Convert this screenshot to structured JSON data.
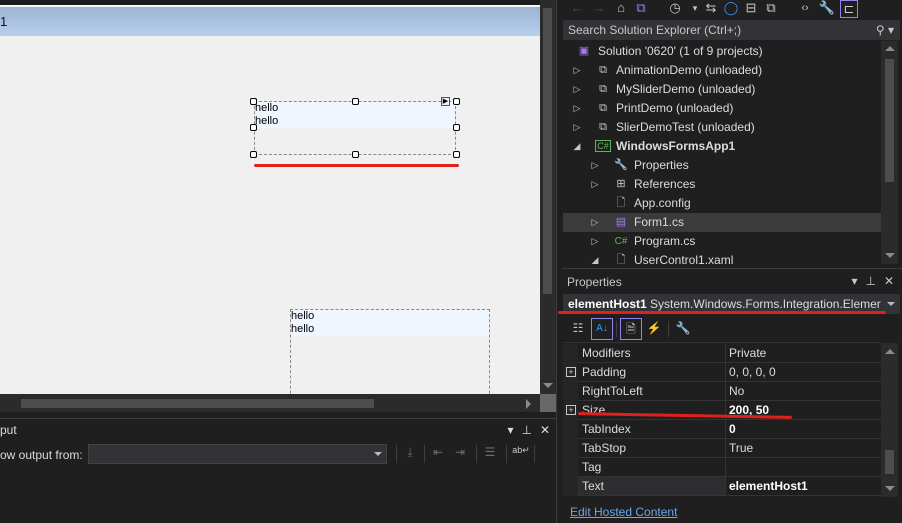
{
  "designer": {
    "form_title": "1",
    "host1": {
      "lines": [
        "hello",
        "hello"
      ],
      "selected": true
    },
    "host2": {
      "lines": [
        "hello",
        "hello"
      ],
      "selected": false
    },
    "annotation_color": "#e0201c"
  },
  "output": {
    "title": "put",
    "show_from_label": "ow output from:",
    "source_value": "",
    "controls": {
      "dropdown": "▾",
      "pin": "⊥",
      "close": "✕"
    },
    "toolbar_icons": [
      "go-to-line-icon",
      "previous-message-icon",
      "next-message-icon",
      "clear-all-icon",
      "word-wrap-icon"
    ]
  },
  "solution_explorer": {
    "toolbar_icons": [
      "back-icon",
      "forward-icon",
      "home-icon",
      "vs-switch-views-icon",
      "pending-changes-icon",
      "sync-icon",
      "refresh-icon",
      "collapse-all-icon",
      "show-all-files-icon",
      "view-code-icon",
      "properties-icon",
      "preview-icon"
    ],
    "search_placeholder": "Search Solution Explorer (Ctrl+;)",
    "items": [
      {
        "label": "Solution '0620' (1 of 9 projects)",
        "icon": "solution-icon",
        "expander": "",
        "level": 0,
        "bold": false
      },
      {
        "label": "AnimationDemo (unloaded)",
        "icon": "project-unloaded-icon",
        "expander": "▷",
        "level": 1,
        "bold": false
      },
      {
        "label": "MySliderDemo (unloaded)",
        "icon": "project-unloaded-icon",
        "expander": "▷",
        "level": 1,
        "bold": false
      },
      {
        "label": "PrintDemo (unloaded)",
        "icon": "project-unloaded-icon",
        "expander": "▷",
        "level": 1,
        "bold": false
      },
      {
        "label": "SlierDemoTest (unloaded)",
        "icon": "project-unloaded-icon",
        "expander": "▷",
        "level": 1,
        "bold": false
      },
      {
        "label": "WindowsFormsApp1",
        "icon": "csharp-project-icon",
        "expander": "◢",
        "level": 1,
        "bold": true
      },
      {
        "label": "Properties",
        "icon": "wrench-icon",
        "expander": "▷",
        "level": 2,
        "bold": false
      },
      {
        "label": "References",
        "icon": "references-icon",
        "expander": "▷",
        "level": 2,
        "bold": false
      },
      {
        "label": "App.config",
        "icon": "config-file-icon",
        "expander": "",
        "level": 2,
        "bold": false
      },
      {
        "label": "Form1.cs",
        "icon": "form-icon",
        "expander": "▷",
        "level": 2,
        "bold": false,
        "selected": true
      },
      {
        "label": "Program.cs",
        "icon": "csharp-file-icon",
        "expander": "▷",
        "level": 2,
        "bold": false
      },
      {
        "label": "UserControl1.xaml",
        "icon": "xaml-file-icon",
        "expander": "◢",
        "level": 2,
        "bold": false
      }
    ]
  },
  "properties": {
    "title": "Properties",
    "controls": {
      "dropdown": "▾",
      "pin": "⊥",
      "close": "✕"
    },
    "object_name": "elementHost1",
    "object_type": "System.Windows.Forms.Integration.Elemer",
    "toolbar_icons": [
      "categorized-icon",
      "alphabetical-icon",
      "properties-icon",
      "events-icon",
      "property-pages-icon"
    ],
    "rows": [
      {
        "name": "Modifiers",
        "value": "Private",
        "expandable": false,
        "bold": false
      },
      {
        "name": "Padding",
        "value": "0, 0, 0, 0",
        "expandable": true,
        "bold": false
      },
      {
        "name": "RightToLeft",
        "value": "No",
        "expandable": false,
        "bold": false
      },
      {
        "name": "Size",
        "value": "200, 50",
        "expandable": true,
        "bold": true
      },
      {
        "name": "TabIndex",
        "value": "0",
        "expandable": false,
        "bold": true
      },
      {
        "name": "TabStop",
        "value": "True",
        "expandable": false,
        "bold": false
      },
      {
        "name": "Tag",
        "value": "",
        "expandable": false,
        "bold": false
      },
      {
        "name": "Text",
        "value": "elementHost1",
        "expandable": false,
        "bold": true,
        "selected": true
      }
    ],
    "link": "Edit Hosted Content"
  }
}
